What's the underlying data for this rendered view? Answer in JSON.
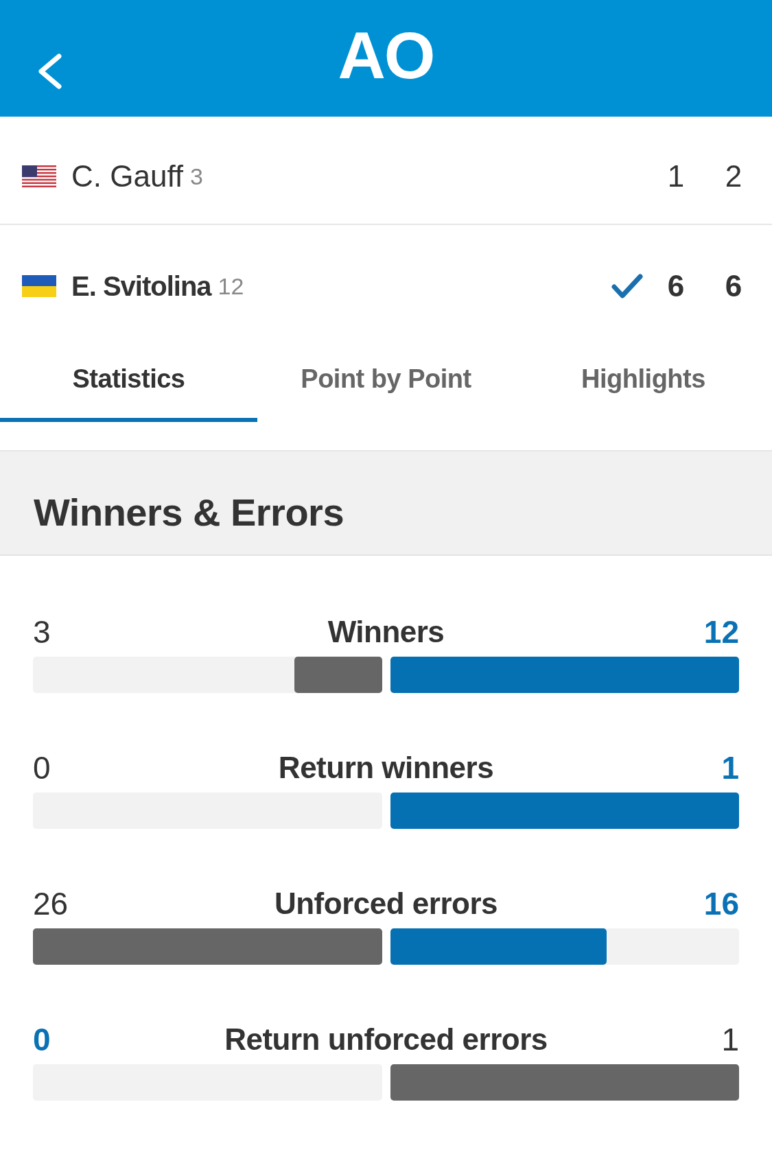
{
  "header": {
    "logo": "AO"
  },
  "players": [
    {
      "flag": {
        "kind": "us"
      },
      "name": "C. Gauff",
      "seed": "3",
      "winner": false,
      "sets": [
        "1",
        "2"
      ]
    },
    {
      "flag": {
        "kind": "ua"
      },
      "name": "E. Svitolina",
      "seed": "12",
      "winner": true,
      "sets": [
        "6",
        "6"
      ]
    }
  ],
  "tabs": [
    {
      "label": "Statistics",
      "selected": true
    },
    {
      "label": "Point by Point",
      "selected": false
    },
    {
      "label": "Highlights",
      "selected": false
    }
  ],
  "section": {
    "title": "Winners & Errors",
    "stats": [
      {
        "label": "Winners",
        "left": {
          "value": "3",
          "level": 0.25,
          "highlighted": false
        },
        "right": {
          "value": "12",
          "level": 1,
          "highlighted": true
        }
      },
      {
        "label": "Return winners",
        "left": {
          "value": "0",
          "highlighted": false
        },
        "right": {
          "value": "1",
          "level": 1,
          "highlighted": true
        }
      },
      {
        "label": "Unforced errors",
        "left": {
          "value": "26",
          "level": 1,
          "highlighted": false
        },
        "right": {
          "value": "16",
          "level": 0.62,
          "highlighted": true
        }
      },
      {
        "label": "Return unforced errors",
        "left": {
          "value": "0",
          "highlighted": true
        },
        "right": {
          "value": "1",
          "level": 1,
          "highlighted": false
        }
      }
    ]
  }
}
